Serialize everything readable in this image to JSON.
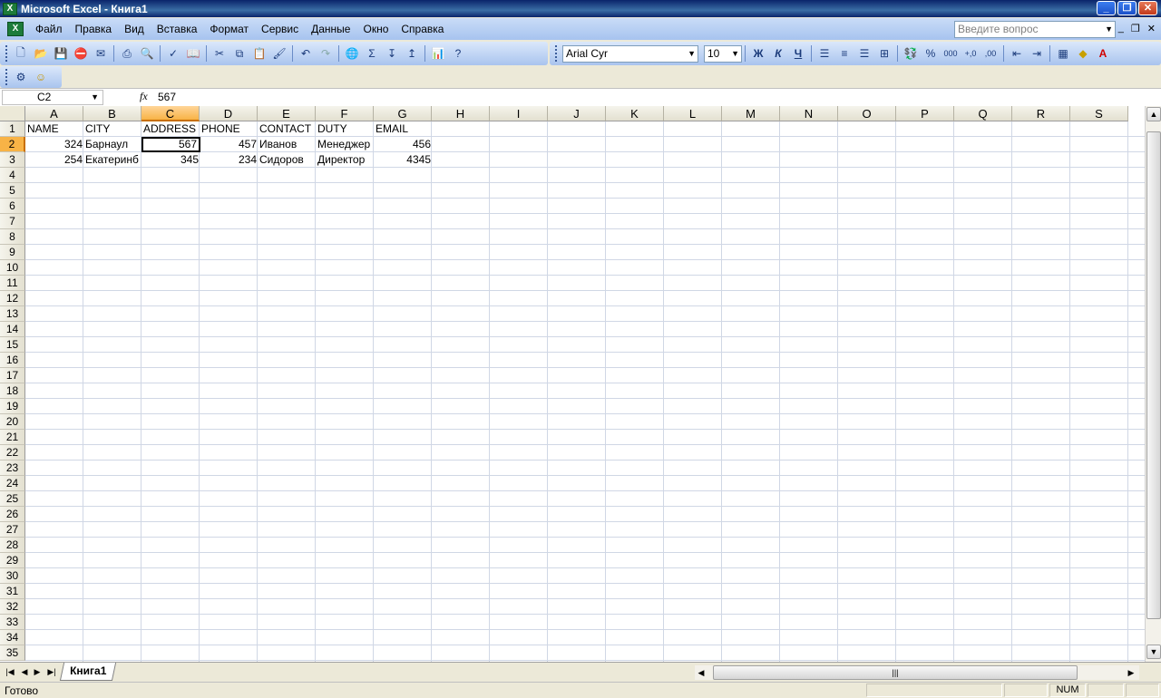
{
  "window": {
    "title": "Microsoft Excel - Книга1",
    "app_icon": "excel-icon"
  },
  "menu": [
    "Файл",
    "Правка",
    "Вид",
    "Вставка",
    "Формат",
    "Сервис",
    "Данные",
    "Окно",
    "Справка"
  ],
  "help_box": {
    "placeholder": "Введите вопрос"
  },
  "toolbar": {
    "font": "Arial Cyr",
    "size": "10",
    "bold": "Ж",
    "italic": "К",
    "underline": "Ч",
    "percent": "%",
    "sum": "Σ"
  },
  "formula_bar": {
    "name_box": "C2",
    "fx": "fx",
    "value": "567"
  },
  "columns": [
    "A",
    "B",
    "C",
    "D",
    "E",
    "F",
    "G",
    "H",
    "I",
    "J",
    "K",
    "L",
    "M",
    "N",
    "O",
    "P",
    "Q",
    "R",
    "S"
  ],
  "selected": {
    "col": "C",
    "row": 2
  },
  "rows_count": 35,
  "cells": [
    {
      "col": 0,
      "row": 1,
      "v": "NAME"
    },
    {
      "col": 1,
      "row": 1,
      "v": "CITY"
    },
    {
      "col": 2,
      "row": 1,
      "v": "ADDRESS"
    },
    {
      "col": 3,
      "row": 1,
      "v": "PHONE"
    },
    {
      "col": 4,
      "row": 1,
      "v": "CONTACT"
    },
    {
      "col": 5,
      "row": 1,
      "v": "DUTY"
    },
    {
      "col": 6,
      "row": 1,
      "v": "EMAIL"
    },
    {
      "col": 0,
      "row": 2,
      "v": "324",
      "num": true
    },
    {
      "col": 1,
      "row": 2,
      "v": "Барнаул"
    },
    {
      "col": 2,
      "row": 2,
      "v": "567",
      "num": true
    },
    {
      "col": 3,
      "row": 2,
      "v": "457",
      "num": true
    },
    {
      "col": 4,
      "row": 2,
      "v": "Иванов"
    },
    {
      "col": 5,
      "row": 2,
      "v": "Менеджер"
    },
    {
      "col": 6,
      "row": 2,
      "v": "456",
      "num": true
    },
    {
      "col": 0,
      "row": 3,
      "v": "254",
      "num": true
    },
    {
      "col": 1,
      "row": 3,
      "v": "Екатеринб"
    },
    {
      "col": 2,
      "row": 3,
      "v": "345",
      "num": true
    },
    {
      "col": 3,
      "row": 3,
      "v": "234",
      "num": true
    },
    {
      "col": 4,
      "row": 3,
      "v": "Сидоров"
    },
    {
      "col": 5,
      "row": 3,
      "v": "Директор"
    },
    {
      "col": 6,
      "row": 3,
      "v": "4345",
      "num": true
    }
  ],
  "sheets": [
    "Книга1"
  ],
  "status": {
    "ready": "Готово",
    "num": "NUM"
  }
}
